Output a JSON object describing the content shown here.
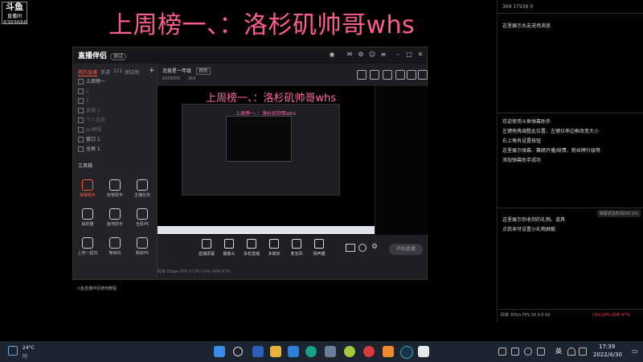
{
  "overlay": {
    "logo_main": "斗鱼",
    "logo_sub": "直播间",
    "room_number": "8369666",
    "stream_title": "上周榜一、：洛杉矶帅哥whs"
  },
  "app": {
    "brand": "直播伴侣",
    "version": "测试",
    "tabs": [
      "我的直播",
      "手游",
      "111",
      "测试场"
    ],
    "scenes": [
      {
        "label": "上周榜一",
        "dim": false
      },
      {
        "label": "1",
        "dim": true
      },
      {
        "label": "1",
        "dim": true
      },
      {
        "label": "直播 1",
        "dim": true
      },
      {
        "label": "个人信息",
        "dim": true
      },
      {
        "label": "pc模版",
        "dim": true
      },
      {
        "label": "窗口 1",
        "dim": false
      },
      {
        "label": "全屏 1",
        "dim": false
      }
    ],
    "tools_heading": "工具箱",
    "tools": [
      {
        "label": "弹幕助手",
        "hot": true
      },
      {
        "label": "房管助手",
        "hot": false
      },
      {
        "label": "主播任务",
        "hot": false
      },
      {
        "label": "抽奖器",
        "hot": false
      },
      {
        "label": "鱼吧助手",
        "hot": false
      },
      {
        "label": "全民PK",
        "hot": false
      },
      {
        "label": "上传一起玩",
        "hot": false
      },
      {
        "label": "等级玩",
        "hot": false
      },
      {
        "label": "跨房PK",
        "hot": false
      }
    ],
    "sidebar_footer": "斗鱼直播伴侣使用教程",
    "room_name": "北极星一年级",
    "room_badge": "搏新",
    "room_meta": "8359556",
    "room_fans": "364",
    "preview_title": "上周榜一、：洛杉矶帅哥whs",
    "controls": [
      "直播屏幕",
      "摄像头",
      "多机直播",
      "多媒体",
      "麦克风",
      "扬声器"
    ],
    "start_label": "开始直播",
    "status": "码率 0kbps   FPS 0   CPU 14%   内存 47%"
  },
  "right_panel": {
    "top_stats": "  369     17936     0",
    "lines_top": [
      "这里展示水友进场消息"
    ],
    "lines_mid": [
      "欢迎使用斗鱼弹幕助手",
      "左键拖拽调整此位置、左键拉伸边框改变大小",
      "右上角有设置按钮",
      "这里展示弹幕、赛绩开播/续费、粉丝牌升级等",
      "添加弹幕助手成功"
    ],
    "tag": "弹幕发送时间(00:10)",
    "lines_bot": [
      "这里展示你收到的礼物、道具",
      "点我来可设置小礼物屏蔽"
    ],
    "footer_stats": "码率  355/s  FPS 30   0  0  00",
    "cpu": "CPU 19%   内存 47%"
  },
  "taskbar": {
    "temp": "24°C",
    "weather": "阴",
    "lang": "英",
    "time": "17:39",
    "date": "2022/4/30"
  }
}
